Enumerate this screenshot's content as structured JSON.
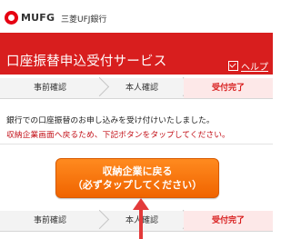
{
  "brand": {
    "logo_text": "MUFG",
    "bank_name": "三菱UFJ銀行"
  },
  "header": {
    "title": "口座振替申込受付サービス",
    "help_label": "ヘルプ"
  },
  "steps": [
    "事前確認",
    "本人確認",
    "受付完了"
  ],
  "message": {
    "line1": "銀行での口座振替のお申し込みを受け付けいたしました。",
    "line2": "収納企業画面へ戻るため、下記ボタンをタップしてください。"
  },
  "cta": {
    "line1": "収納企業に戻る",
    "line2": "（必ずタップしてください）"
  },
  "colors": {
    "brand_red": "#d81e1e",
    "cta_orange": "#f47a12"
  }
}
